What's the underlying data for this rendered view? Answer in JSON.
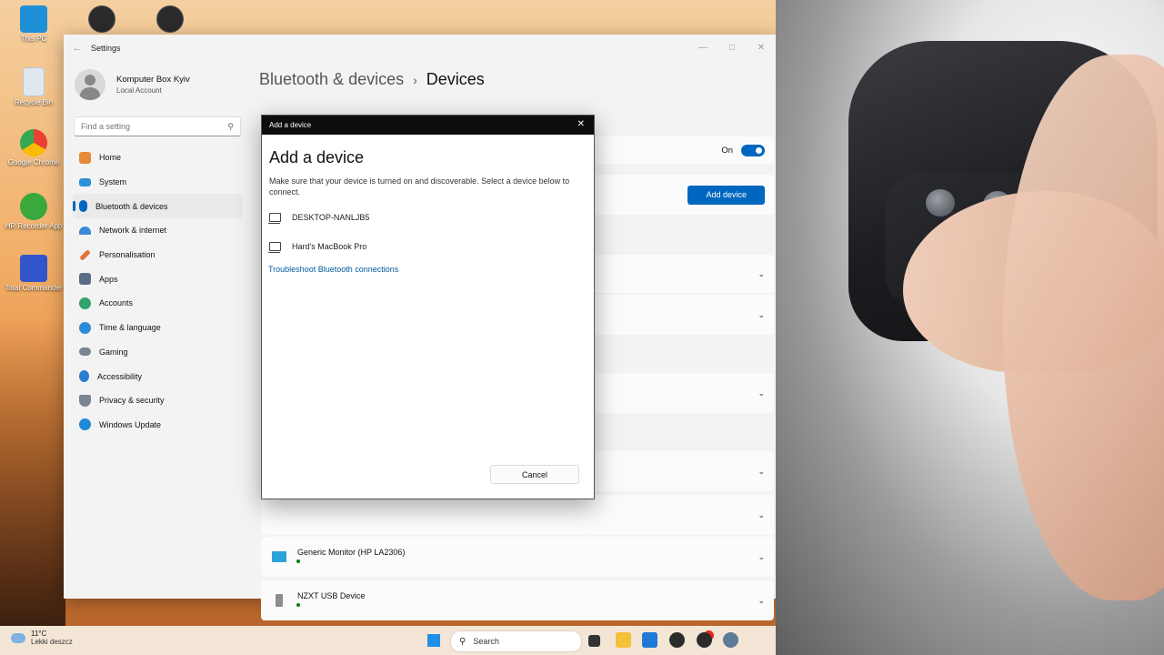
{
  "desktop": {
    "icons": [
      {
        "label": "This PC",
        "icon": "monitor-icon",
        "color": "#1f8fd8"
      },
      {
        "label": "Recycle Bin",
        "icon": "recycle-bin-icon",
        "color": "#dfe7ef"
      },
      {
        "label": "Google Chrome",
        "icon": "chrome-icon",
        "color": "#e94235"
      },
      {
        "label": "HR Recorder App",
        "icon": "power-icon",
        "color": "#3aa83a"
      },
      {
        "label": "Total Commander",
        "icon": "floppy-icon",
        "color": "#3355cc"
      }
    ]
  },
  "settings": {
    "title": "Settings",
    "profile": {
      "name": "Komputer Box Kyiv",
      "account": "Local Account"
    },
    "search": {
      "placeholder": "Find a setting"
    },
    "nav": [
      {
        "label": "Home",
        "icon": "home-icon",
        "color": "#e58b3a"
      },
      {
        "label": "System",
        "icon": "system-icon",
        "color": "#2b90d9"
      },
      {
        "label": "Bluetooth & devices",
        "icon": "bluetooth-icon",
        "color": "#0067c0"
      },
      {
        "label": "Network & internet",
        "icon": "wifi-icon",
        "color": "#3b8ad6"
      },
      {
        "label": "Personalisation",
        "icon": "brush-icon",
        "color": "#e1743b"
      },
      {
        "label": "Apps",
        "icon": "apps-icon",
        "color": "#5a6d86"
      },
      {
        "label": "Accounts",
        "icon": "person-icon",
        "color": "#2fa36b"
      },
      {
        "label": "Time & language",
        "icon": "globe-icon",
        "color": "#2f8ad6"
      },
      {
        "label": "Gaming",
        "icon": "gamepad-icon",
        "color": "#7b8592"
      },
      {
        "label": "Accessibility",
        "icon": "accessibility-icon",
        "color": "#2b7fd1"
      },
      {
        "label": "Privacy & security",
        "icon": "shield-icon",
        "color": "#7b8592"
      },
      {
        "label": "Windows Update",
        "icon": "update-icon",
        "color": "#1f8ad6"
      }
    ],
    "active_nav": "Bluetooth & devices",
    "breadcrumb": {
      "parent": "Bluetooth & devices",
      "separator": "›",
      "current": "Devices"
    },
    "bluetooth": {
      "state_label": "On"
    },
    "add_device_label": "Add device",
    "devices": [
      {
        "name": "Generic Monitor (HP LA2306)",
        "icon": "monitor-icon"
      },
      {
        "name": "NZXT USB Device",
        "icon": "usb-device-icon"
      }
    ]
  },
  "dialog": {
    "title": "Add a device",
    "heading": "Add a device",
    "description": "Make sure that your device is turned on and discoverable. Select a device below to connect.",
    "devices": [
      {
        "name": "DESKTOP-NANLJB5",
        "icon": "laptop-icon"
      },
      {
        "name": "Hard's MacBook Pro",
        "icon": "laptop-icon"
      }
    ],
    "link": "Troubleshoot Bluetooth connections",
    "cancel_label": "Cancel"
  },
  "taskbar": {
    "weather": {
      "temp": "11°C",
      "condition": "Lekki deszcz"
    },
    "search_label": "Search"
  },
  "colors": {
    "accent": "#0067c0",
    "link": "#005a9e",
    "connected": "#0f7b0f"
  }
}
